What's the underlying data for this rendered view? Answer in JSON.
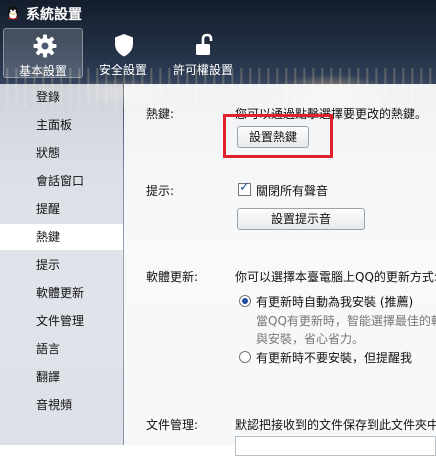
{
  "window": {
    "title": "系統設置"
  },
  "toolbar": {
    "items": [
      {
        "label": "基本設置",
        "icon": "gear-icon",
        "active": true
      },
      {
        "label": "安全設置",
        "icon": "shield-icon",
        "active": false
      },
      {
        "label": "許可權設置",
        "icon": "lock-icon",
        "active": false
      }
    ]
  },
  "sidebar": {
    "items": [
      {
        "label": "登錄"
      },
      {
        "label": "主面板"
      },
      {
        "label": "狀態"
      },
      {
        "label": "會話窗口"
      },
      {
        "label": "提醒"
      },
      {
        "label": "熱鍵",
        "selected": true
      },
      {
        "label": "提示"
      },
      {
        "label": "軟體更新"
      },
      {
        "label": "文件管理"
      },
      {
        "label": "語言"
      },
      {
        "label": "翻譯"
      },
      {
        "label": "音視頻"
      }
    ]
  },
  "hotkey": {
    "label": "熱鍵:",
    "description": "您可以通過點擊選擇要更改的熱鍵。",
    "button": "設置熱鍵"
  },
  "prompt": {
    "label": "提示:",
    "checkbox_label": "關閉所有聲音",
    "checkbox_checked": true,
    "button": "設置提示音"
  },
  "update": {
    "label": "軟體更新:",
    "description": "你可以選擇本臺電腦上QQ的更新方式:",
    "option1": "有更新時自動為我安裝 (推薦)",
    "option1_sub_line1": "當QQ有更新時，智能選擇最佳的軟",
    "option1_sub_line2": "與安裝，省心省力。",
    "option2": "有更新時不要安裝，但提醒我",
    "selected": "option1"
  },
  "files": {
    "label": "文件管理:",
    "description": "默認把接收到的文件保存到此文件夾中"
  },
  "colors": {
    "highlight": "#e0202a",
    "accent": "#1f4f9c"
  }
}
